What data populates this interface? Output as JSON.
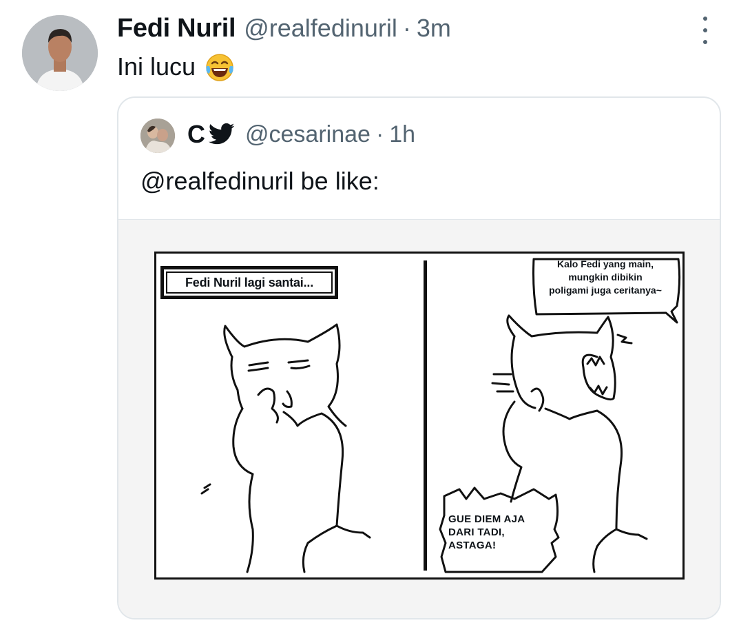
{
  "tweet": {
    "author_name": "Fedi Nuril",
    "author_handle": "@realfedinuril",
    "separator": "·",
    "time": "3m",
    "text": "Ini lucu",
    "emoji": "face-with-tears-of-joy"
  },
  "more_icon": "more-vertical-icon",
  "quoted": {
    "author_name": "C",
    "name_icon": "twitter-bird-icon",
    "author_handle": "@cesarinae",
    "separator": "·",
    "time": "1h",
    "text": "@realfedinuril be like:",
    "comic": {
      "caption": "Fedi Nuril lagi santai...",
      "speech_top": [
        "Kalo Fedi yang main,",
        "mungkin dibikin",
        "poligami juga ceritanya~"
      ],
      "speech_bottom": [
        "GUE DIEM AJA",
        "DARI TADI,",
        "ASTAGA!"
      ]
    }
  },
  "colors": {
    "text": "#0f1419",
    "secondary": "#536471",
    "border": "#e1e6ea"
  }
}
